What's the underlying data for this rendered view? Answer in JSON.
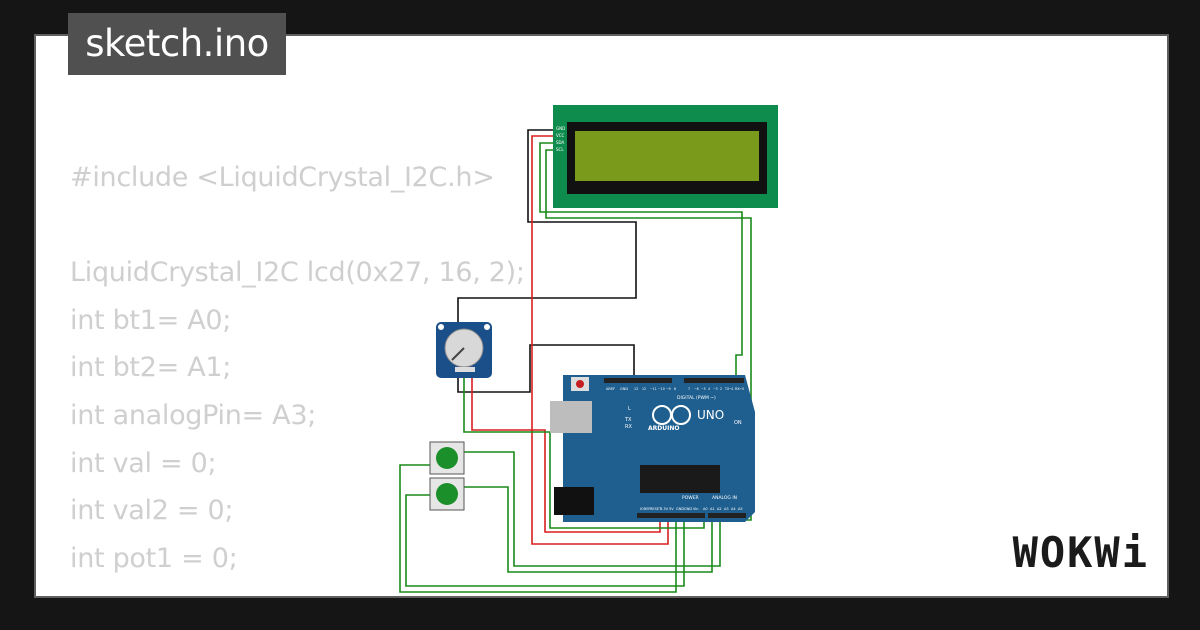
{
  "header": {
    "filename": "sketch.ino"
  },
  "code_lines": [
    "#include <LiquidCrystal_I2C.h>",
    "",
    "LiquidCrystal_I2C lcd(0x27, 16, 2);",
    "int bt1= A0;",
    "int bt2= A1;",
    "int analogPin= A3;",
    "int val = 0;",
    "int val2 = 0;",
    "int pot1 = 0;"
  ],
  "brand": {
    "name": "WOKWi"
  },
  "board": {
    "brand_label": "ARDUINO",
    "model_label": "UNO",
    "digital_label": "DIGITAL (PWM ~)",
    "power_label": "POWER",
    "analog_label": "ANALOG IN",
    "tx_label": "TX",
    "rx_label": "RX",
    "l_label": "L",
    "on_label": "ON",
    "aref_label": "AREF",
    "gnd_label": "GND",
    "power_pins": [
      "IOREF",
      "RESET",
      "3.3V",
      "5V",
      "GND",
      "GND",
      "Vin"
    ],
    "analog_pins": [
      "A0",
      "A1",
      "A2",
      "A3",
      "A4",
      "A5"
    ],
    "digital_pins": [
      "13",
      "12",
      "~11",
      "~10",
      "~9",
      "8",
      "7",
      "~6",
      "~5",
      "4",
      "~3",
      "2",
      "TX→1",
      "RX←0"
    ]
  },
  "lcd": {
    "pins": [
      "GND",
      "VCC",
      "SDA",
      "SCL"
    ]
  },
  "colors": {
    "wire_red": "#d81f1f",
    "wire_black": "#111111",
    "wire_green": "#1a8a1a",
    "board_blue": "#1f5f8f",
    "lcd_green": "#0e8c4e",
    "lcd_screen": "#7a9a1c",
    "button_green": "#1a8f2a",
    "pot_blue": "#1a4f8a"
  }
}
